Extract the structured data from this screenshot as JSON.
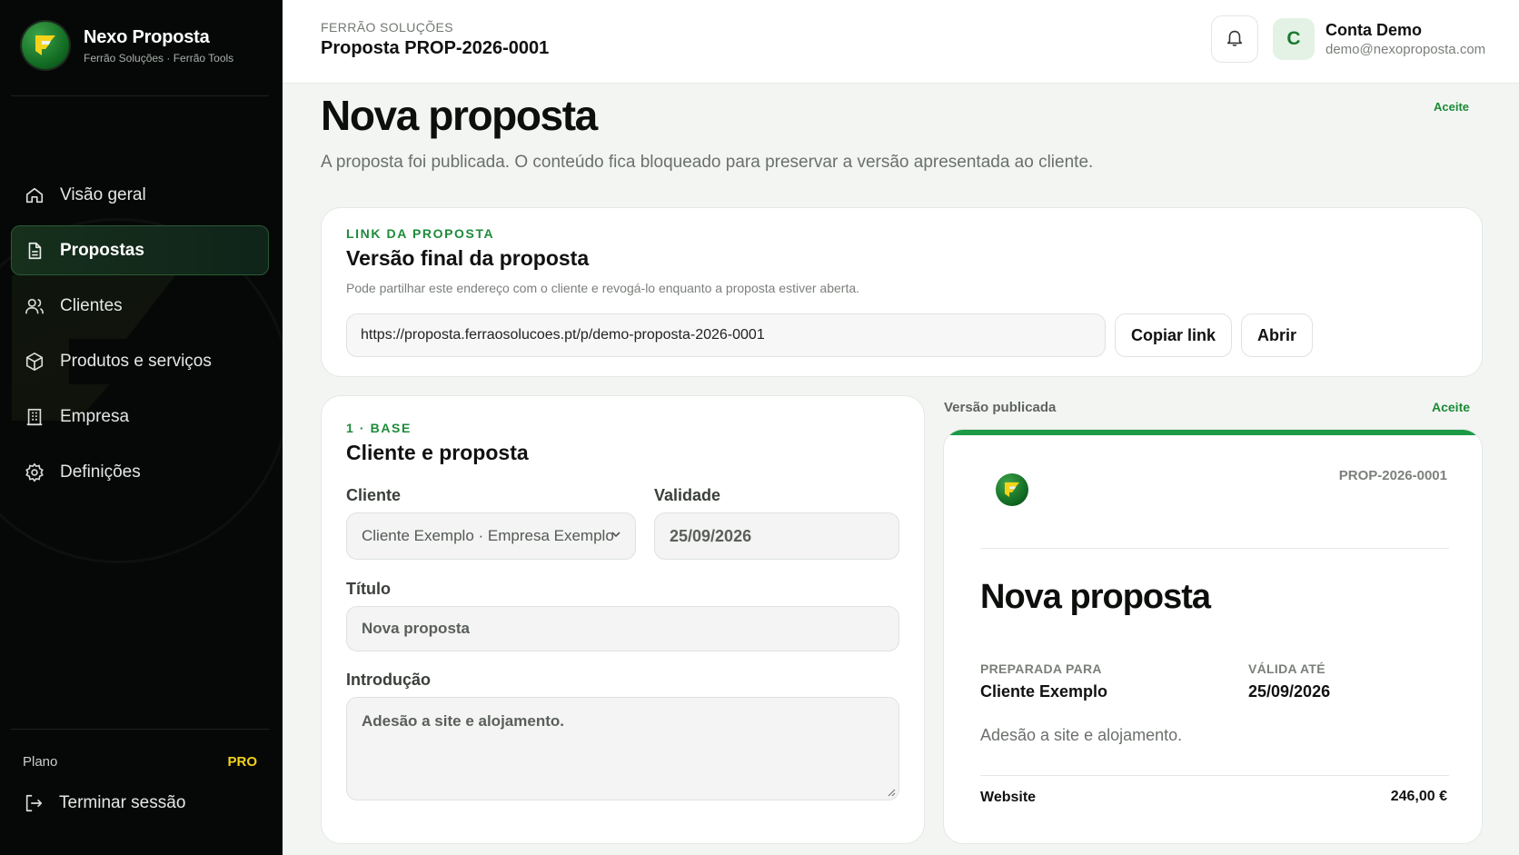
{
  "brand": {
    "title": "Nexo Proposta",
    "subtitle": "Ferrão Soluções · Ferrão Tools"
  },
  "sidebar": {
    "items": [
      {
        "label": "Visão geral",
        "icon": "home-icon",
        "active": false
      },
      {
        "label": "Propostas",
        "icon": "document-icon",
        "active": true
      },
      {
        "label": "Clientes",
        "icon": "users-icon",
        "active": false
      },
      {
        "label": "Produtos e serviços",
        "icon": "box-icon",
        "active": false
      },
      {
        "label": "Empresa",
        "icon": "building-icon",
        "active": false
      },
      {
        "label": "Definições",
        "icon": "gear-icon",
        "active": false
      }
    ],
    "plan_label": "Plano",
    "plan_value": "PRO",
    "logout_label": "Terminar sessão"
  },
  "header": {
    "company": "FERRÃO SOLUÇÕES",
    "proposal": "Proposta PROP-2026-0001",
    "user": {
      "initial": "C",
      "name": "Conta Demo",
      "email": "demo@nexoproposta.com"
    }
  },
  "main": {
    "title": "Nova proposta",
    "status": "Aceite",
    "subtitle": "A proposta foi publicada. O conteúdo fica bloqueado para preservar a versão apresentada ao cliente."
  },
  "link_card": {
    "eyebrow": "LINK DA PROPOSTA",
    "title": "Versão final da proposta",
    "description": "Pode partilhar este endereço com o cliente e revogá-lo enquanto a proposta estiver aberta.",
    "url": "https://proposta.ferraosolucoes.pt/p/demo-proposta-2026-0001",
    "copy_label": "Copiar link",
    "open_label": "Abrir"
  },
  "base_card": {
    "eyebrow": "1 · BASE",
    "title": "Cliente e proposta",
    "client_label": "Cliente",
    "client_value": "Cliente Exemplo · Empresa Exemplo",
    "validity_label": "Validade",
    "validity_value": "25/09/2026",
    "title_label": "Título",
    "title_value": "Nova proposta",
    "intro_label": "Introdução",
    "intro_value": "Adesão a site e alojamento."
  },
  "preview": {
    "label": "Versão publicada",
    "status": "Aceite",
    "id": "PROP-2026-0001",
    "title": "Nova proposta",
    "prepared_label": "PREPARADA PARA",
    "prepared_value": "Cliente Exemplo",
    "valid_label": "VÁLIDA ATÉ",
    "valid_value": "25/09/2026",
    "intro": "Adesão a site e alojamento.",
    "item_name": "Website",
    "item_price": "246,00 €"
  },
  "colors": {
    "accent": "#1c9a45",
    "sidebar_bg": "#060807",
    "plan_badge": "#f2d21b"
  }
}
